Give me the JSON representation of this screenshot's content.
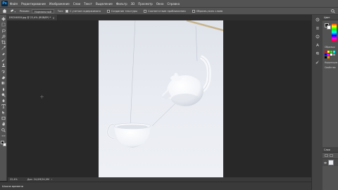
{
  "app": {
    "logo_text": "Ps"
  },
  "menu": {
    "items": [
      "Файл",
      "Редактирование",
      "Изображение",
      "Слои",
      "Текст",
      "Выделение",
      "Фильтр",
      "3D",
      "Просмотр",
      "Окно",
      "Справка"
    ]
  },
  "options": {
    "tool_icon": "spot-healing-brush-icon",
    "mode_label": "Режим:",
    "mode_value": "Нормальный",
    "type_label": "Тип:",
    "type_options": [
      "С учетом содержимого",
      "Создание текстуры",
      "Соответствие приближения"
    ],
    "type_selected": "С учетом содержимого",
    "sample_all_layers": "Образец всех слоев"
  },
  "document": {
    "tab_label": "DSC04818.jpg @ 22,4% (RGB/8*) *",
    "close_glyph": "×"
  },
  "status": {
    "zoom": "22,4%",
    "docinfo": "Док: 24,0M/24,0M",
    "arrow": "›"
  },
  "timeline": {
    "label": "Шкала времени"
  },
  "panels": {
    "top_label": "Цвет",
    "row_labels": [
      "Образцы",
      "Коррекция",
      "Свойства"
    ],
    "layers_label": "Слои"
  },
  "colors": {
    "foreground": "#1a1a1a",
    "background": "#ffffff",
    "accent": "#31a8ff",
    "photo_background": "#e8ebf1"
  },
  "icons": {
    "toolbar": [
      "move-icon",
      "marquee-icon",
      "lasso-icon",
      "quick-select-icon",
      "crop-icon",
      "eyedropper-icon",
      "healing-brush-icon",
      "brush-icon",
      "clone-stamp-icon",
      "history-brush-icon",
      "eraser-icon",
      "gradient-icon",
      "blur-icon",
      "dodge-icon",
      "pen-icon",
      "type-icon",
      "path-select-icon",
      "rectangle-icon",
      "hand-icon",
      "zoom-icon",
      "more-tools-icon"
    ],
    "panel_strip": [
      "history-icon",
      "properties-icon",
      "info-icon",
      "character-icon",
      "paragraph-icon",
      "brush-settings-icon"
    ]
  }
}
